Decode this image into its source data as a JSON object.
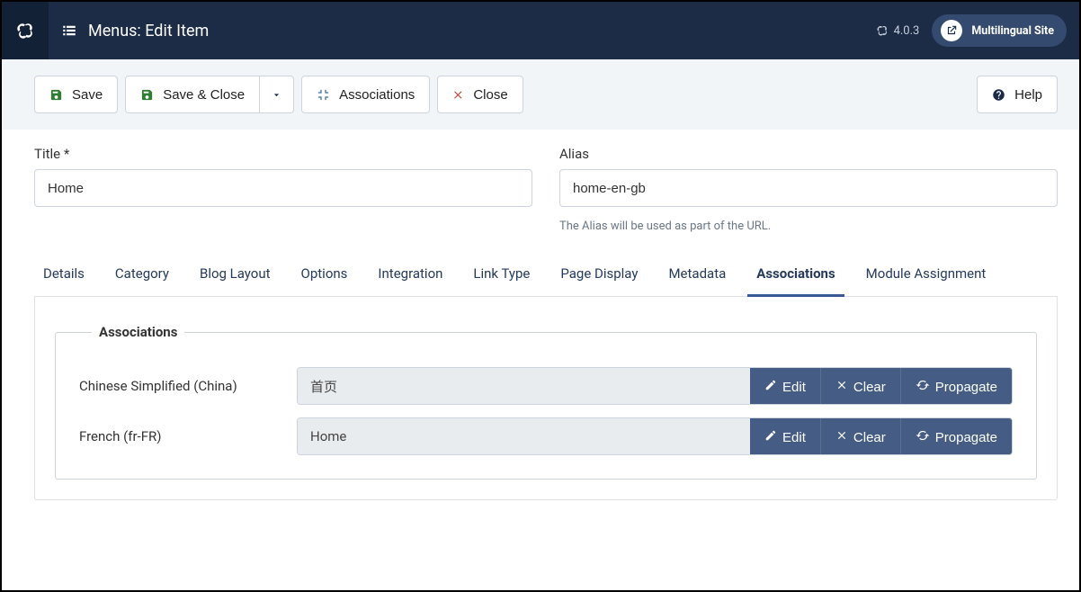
{
  "header": {
    "page_title": "Menus: Edit Item",
    "version": "4.0.3",
    "site_pill": "Multilingual Site"
  },
  "toolbar": {
    "save": "Save",
    "save_close": "Save & Close",
    "associations": "Associations",
    "close": "Close",
    "help": "Help"
  },
  "form": {
    "title_label": "Title *",
    "title_value": "Home",
    "alias_label": "Alias",
    "alias_value": "home-en-gb",
    "alias_help": "The Alias will be used as part of the URL."
  },
  "tabs": [
    {
      "label": "Details",
      "active": false
    },
    {
      "label": "Category",
      "active": false
    },
    {
      "label": "Blog Layout",
      "active": false
    },
    {
      "label": "Options",
      "active": false
    },
    {
      "label": "Integration",
      "active": false
    },
    {
      "label": "Link Type",
      "active": false
    },
    {
      "label": "Page Display",
      "active": false
    },
    {
      "label": "Metadata",
      "active": false
    },
    {
      "label": "Associations",
      "active": true
    },
    {
      "label": "Module Assignment",
      "active": false
    }
  ],
  "associations": {
    "legend": "Associations",
    "rows": [
      {
        "lang_label": "Chinese Simplified (China)",
        "value": "首页",
        "edit": "Edit",
        "clear": "Clear",
        "propagate": "Propagate"
      },
      {
        "lang_label": "French (fr-FR)",
        "value": "Home",
        "edit": "Edit",
        "clear": "Clear",
        "propagate": "Propagate"
      }
    ]
  }
}
